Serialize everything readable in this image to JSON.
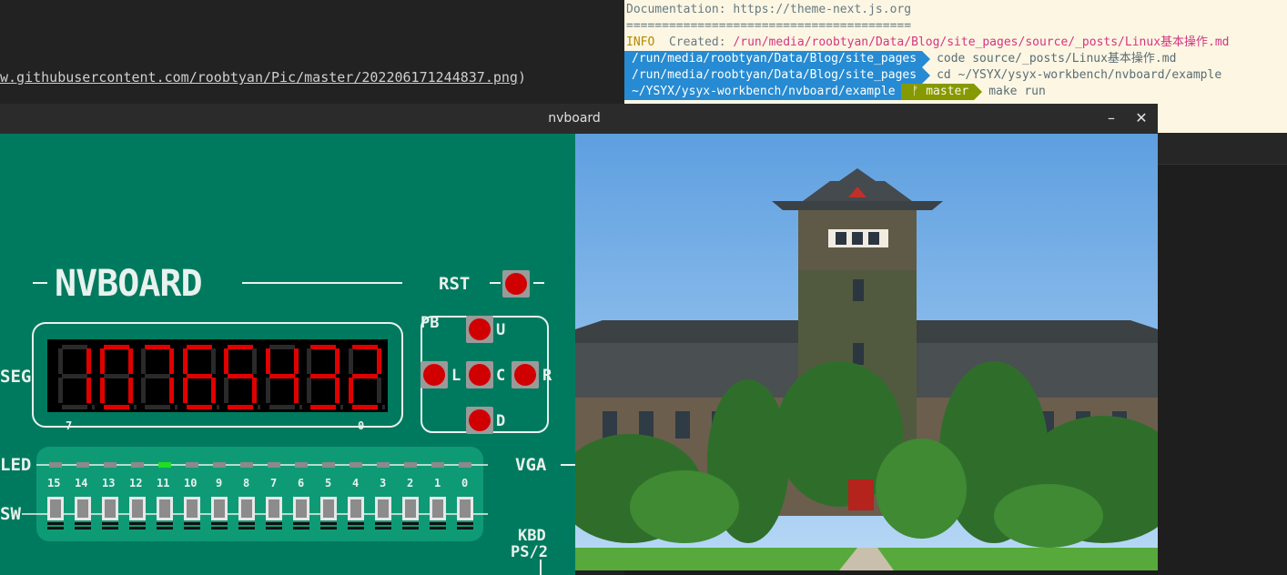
{
  "editor": {
    "line": "w.githubusercontent.com/roobtyan/Pic/master/202206171244837.png",
    "line_close": ")"
  },
  "terminal": {
    "doc_line": "Documentation: https://theme-next.js.org",
    "rule": "========================================",
    "info_tag": "INFO",
    "info_created": "Created:",
    "info_path": "/run/media/roobtyan/Data/Blog/site_pages/source/_posts/Linux基本操作.md",
    "prompt1_path": "/run/media/roobtyan/Data/Blog/site_pages",
    "prompt1_cmd": "code source/_posts/Linux基本操作.md",
    "prompt2_path": "/run/media/roobtyan/Data/Blog/site_pages",
    "prompt2_cmd": "cd ~/YSYX/ysyx-workbench/nvboard/example",
    "prompt3_path": "~/YSYX/ysyx-workbench/nvboard/example",
    "prompt3_branch": "ᚠ master",
    "prompt3_cmd": "make run"
  },
  "window": {
    "title": "nvboard",
    "minimize": "–",
    "close": "✕"
  },
  "board": {
    "logo": "NVBOARD",
    "rst": "RST",
    "pb": "PB",
    "seg": "SEG",
    "seg_left": "7",
    "seg_right": "0",
    "led": "LED",
    "sw": "SW",
    "vga": "VGA",
    "kbd": "KBD",
    "ps2": "PS/2",
    "dir_u": "U",
    "dir_l": "L",
    "dir_c": "C",
    "dir_r": "R",
    "dir_d": "D",
    "seg_value": "10765432",
    "switch_numbers": [
      "15",
      "14",
      "13",
      "12",
      "11",
      "10",
      "9",
      "8",
      "7",
      "6",
      "5",
      "4",
      "3",
      "2",
      "1",
      "0"
    ],
    "led_on": [
      false,
      false,
      false,
      false,
      true,
      false,
      false,
      false,
      false,
      false,
      false,
      false,
      false,
      false,
      false,
      false
    ]
  },
  "colors": {
    "board_green": "#007a5e",
    "seg_red": "#e00000",
    "led_on": "#22dd22",
    "button_red": "#d10000"
  }
}
